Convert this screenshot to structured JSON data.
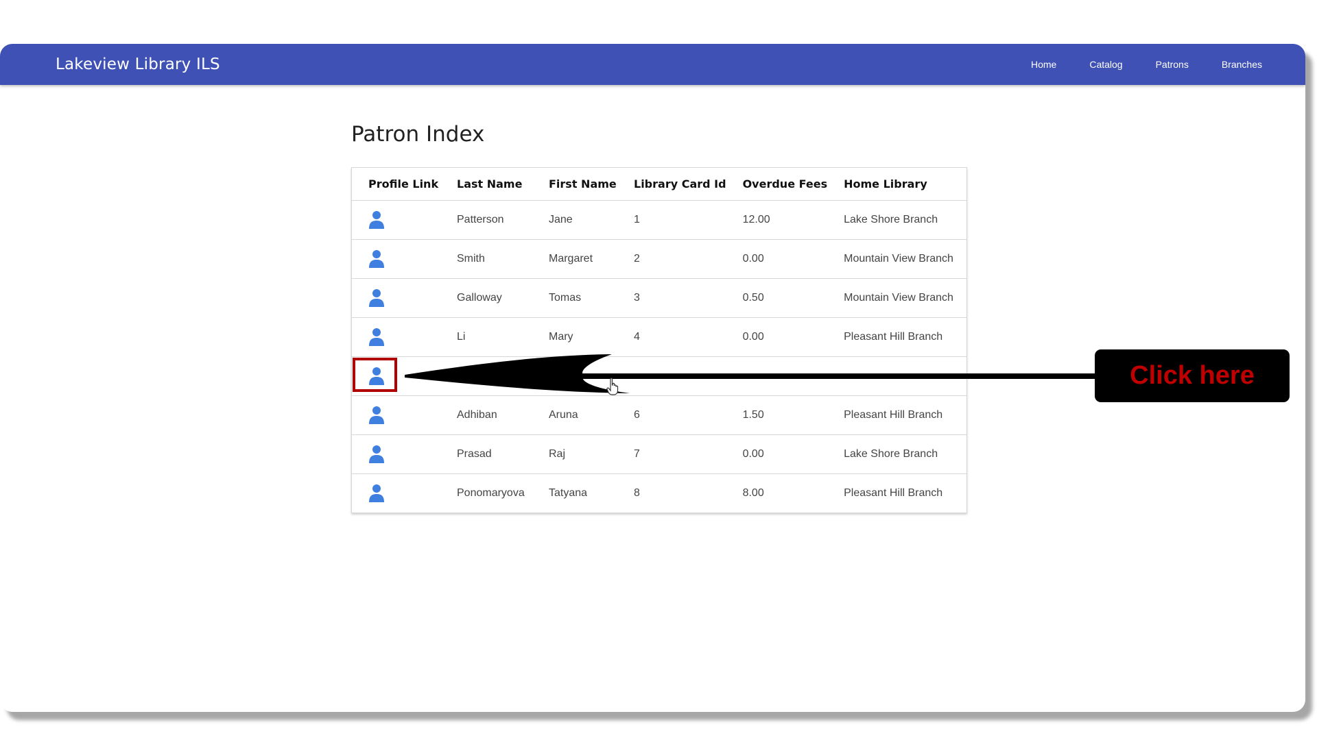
{
  "app": {
    "brand": "Lakeview Library ILS"
  },
  "nav": {
    "items": [
      {
        "label": "Home"
      },
      {
        "label": "Catalog"
      },
      {
        "label": "Patrons"
      },
      {
        "label": "Branches"
      }
    ]
  },
  "page": {
    "title": "Patron Index"
  },
  "table": {
    "headers": [
      "Profile Link",
      "Last Name",
      "First Name",
      "Library Card Id",
      "Overdue Fees",
      "Home Library"
    ],
    "rows": [
      {
        "last": "Patterson",
        "first": "Jane",
        "card": "1",
        "fees": "12.00",
        "home": "Lake Shore Branch"
      },
      {
        "last": "Smith",
        "first": "Margaret",
        "card": "2",
        "fees": "0.00",
        "home": "Mountain View Branch"
      },
      {
        "last": "Galloway",
        "first": "Tomas",
        "card": "3",
        "fees": "0.50",
        "home": "Mountain View Branch"
      },
      {
        "last": "Li",
        "first": "Mary",
        "card": "4",
        "fees": "0.00",
        "home": "Pleasant Hill Branch"
      },
      {
        "last": "",
        "first": "",
        "card": "",
        "fees": "",
        "home": ""
      },
      {
        "last": "Adhiban",
        "first": "Aruna",
        "card": "6",
        "fees": "1.50",
        "home": "Pleasant Hill Branch"
      },
      {
        "last": "Prasad",
        "first": "Raj",
        "card": "7",
        "fees": "0.00",
        "home": "Lake Shore Branch"
      },
      {
        "last": "Ponomaryova",
        "first": "Tatyana",
        "card": "8",
        "fees": "8.00",
        "home": "Pleasant Hill Branch"
      }
    ]
  },
  "annotation": {
    "callout_text": "Click here"
  },
  "colors": {
    "navbar": "#3f51b5",
    "profile_icon": "#3f7fe0",
    "highlight": "#b00000",
    "callout_text": "#c00000"
  },
  "icons": {
    "profile": "user-icon",
    "cursor": "hand-pointer-icon"
  }
}
